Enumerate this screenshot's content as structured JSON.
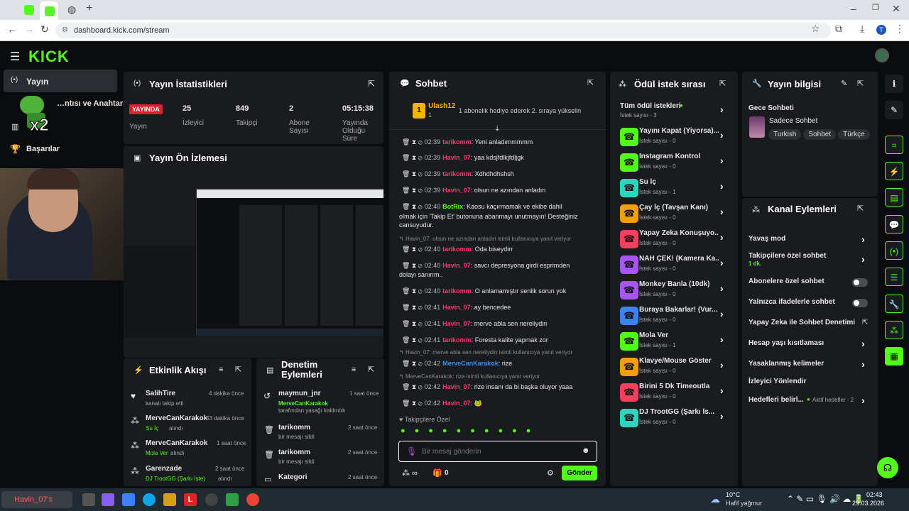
{
  "browser": {
    "url": "dashboard.kick.com/stream",
    "profile": "T"
  },
  "nav": {
    "items": [
      {
        "label": "Yayın"
      },
      {
        "label": "…ntısı ve Anahtarı"
      },
      {
        "label": "Başarılar"
      }
    ],
    "overlay_badge": "x2"
  },
  "stats": {
    "title": "Yayın İstatistikleri",
    "live_badge": "YAYINDA",
    "live_label": "Yayın",
    "viewers": "25",
    "viewers_label": "İzleyici",
    "followers": "849",
    "followers_label": "Takipçi",
    "subs": "2",
    "subs_label": "Abone Sayısı",
    "uptime": "05:15:38",
    "uptime_label": "Yayında Olduğu Süre"
  },
  "preview": {
    "title": "Yayın Ön İzlemesi"
  },
  "activity": {
    "title": "Etkinlik Akışı",
    "items": [
      {
        "user": "SalihTire",
        "time": "4 dakika önce",
        "desc": "kanalı takip etti"
      },
      {
        "user": "MerveCanKarakok",
        "time": "33 dakika önce",
        "reward": "Su İç",
        "desc": "alındı"
      },
      {
        "user": "MerveCanKarakok",
        "time": "1 saat önce",
        "reward": "Mola Ver",
        "desc": "alındı"
      },
      {
        "user": "Garenzade",
        "time": "2 saat önce",
        "reward": "DJ TrootGG (Şarkı İste)",
        "desc": "alındı"
      }
    ]
  },
  "moderation": {
    "title": "Denetim Eylemleri",
    "items": [
      {
        "user": "maymun_jnr",
        "time": "1 saat önce",
        "actor": "MerveCanKarakok",
        "desc": "tarafından yasağı kaldırıldı"
      },
      {
        "user": "tarikomm",
        "time": "2 saat önce",
        "desc": "bir mesajı sildi"
      },
      {
        "user": "tarikomm",
        "time": "2 saat önce",
        "desc": "bir mesajı sildi"
      },
      {
        "user": "Kategori",
        "time": "2 saat önce",
        "desc": ""
      }
    ]
  },
  "chat": {
    "title": "Sohbet",
    "pinned_user": "Ulash12",
    "pinned_count": "1",
    "pinned_text": "1 abonelik hediye ederek 2. sıraya yükselin",
    "messages": [
      {
        "time": "02:39",
        "user": "tarikomm",
        "color": "#ff3b6b",
        "text": "Yeni anladımmmmm"
      },
      {
        "time": "02:39",
        "user": "Havin_07",
        "color": "#ff3b6b",
        "text": "yaa kdsjfdlkjfdljgk"
      },
      {
        "time": "02:39",
        "user": "tarikomm",
        "color": "#ff3b6b",
        "text": "Xdhdhdhshsh"
      },
      {
        "time": "02:39",
        "user": "Havin_07",
        "color": "#ff3b6b",
        "text": "olsun ne azından anladın"
      },
      {
        "time": "02:40",
        "user": "BotRix",
        "color": "#53fc18",
        "text": "Kaosu kaçırmamak ve ekibe dahil"
      },
      {
        "time": "02:40",
        "user": "tarikomm",
        "color": "#ff3b6b",
        "text": "Oda biseydirr"
      },
      {
        "time": "02:40",
        "user": "Havin_07",
        "color": "#ff3b6b",
        "text": "savcı depresyona girdi esprimden"
      },
      {
        "time": "02:40",
        "user": "tarikomm",
        "color": "#ff3b6b",
        "text": "O anlamamıştır senlik sorun yok"
      },
      {
        "time": "02:41",
        "user": "Havin_07",
        "color": "#ff3b6b",
        "text": "ay bencedee"
      },
      {
        "time": "02:41",
        "user": "Havin_07",
        "color": "#ff3b6b",
        "text": "merve abla sen nereliydin"
      },
      {
        "time": "02:41",
        "user": "tarikomm",
        "color": "#ff3b6b",
        "text": "Foresta kalite yapmak zor"
      },
      {
        "time": "02:42",
        "user": "MerveCanKarakok",
        "color": "#3a8ef6",
        "text": "rize"
      },
      {
        "time": "02:42",
        "user": "Havin_07",
        "color": "#ff3b6b",
        "text": "rize insanı da bi başka oluyor yaaa"
      },
      {
        "time": "02:42",
        "user": "Havin_07",
        "color": "#ff3b6b",
        "text": ""
      }
    ],
    "botrix_cont": "olmak için 'Takip Et' butonuna abanmayı unutmayın! Desteğiniz cansuyudur.",
    "savci_cont": "dolayı sanırım..",
    "reply1": "Havin_07: olsun ne azından anladın isimli kullanıcıya yanıt veriyor",
    "reply2": "Havin_07: merve abla sen nereliydin isimli kullanıcıya yanıt veriyor",
    "reply3": "MerveCanKarakok: rize isimli kullanıcıya yanıt veriyor",
    "emote_label": "Takipçilere Özel",
    "placeholder": "Bir mesaj gönderin",
    "send": "Gönder",
    "points": "0"
  },
  "rewards": {
    "title": "Ödül istek sırası",
    "all": "Tüm ödül istekleri",
    "all_count": "İstek sayısı - 3",
    "items": [
      {
        "name": "Yayını Kapat (Yiyorsa)...",
        "count": "İstek sayısı - 0",
        "color": "#53fc18"
      },
      {
        "name": "Instagram Kontrol",
        "count": "İstek sayısı - 0",
        "color": "#53fc18"
      },
      {
        "name": "Su İç",
        "count": "İstek sayısı - 1",
        "color": "#2dd4bf"
      },
      {
        "name": "Çay İç (Tavşan Kanı)",
        "count": "İstek sayısı - 0",
        "color": "#f59e0b"
      },
      {
        "name": "Yapay Zeka Konuşuyo...",
        "count": "İstek sayısı - 0",
        "color": "#f43f5e"
      },
      {
        "name": "NAH ÇEK! (Kamera Ka...",
        "count": "İstek sayısı - 0",
        "color": "#a855f7"
      },
      {
        "name": "Monkey Banla (10dk)",
        "count": "İstek sayısı - 0",
        "color": "#a855f7"
      },
      {
        "name": "Buraya Bakarlar! (Vur...",
        "count": "İstek sayısı - 0",
        "color": "#3b82f6"
      },
      {
        "name": "Mola Ver",
        "count": "İstek sayısı - 1",
        "color": "#53fc18"
      },
      {
        "name": "Klavye/Mouse Göster",
        "count": "İstek sayısı - 0",
        "color": "#f59e0b"
      },
      {
        "name": "Birini 5 Dk Timeoutla",
        "count": "İstek sayısı - 0",
        "color": "#f43f5e"
      },
      {
        "name": "DJ TrootGG (Şarkı İs...",
        "count": "İstek sayısı - 0",
        "color": "#2dd4bf"
      }
    ]
  },
  "info": {
    "title": "Yayın bilgisi",
    "stream_title": "Gece Sohbeti",
    "category": "Sadece Sohbet",
    "tags": [
      "Turkish",
      "Sohbet",
      "Türkçe"
    ]
  },
  "actions": {
    "title": "Kanal Eylemleri",
    "items": [
      "Yavaş mod",
      "Takipçilere özel sohbet",
      "Abonelere özel sohbet",
      "Yalnızca ifadelerle sohbet",
      "Yapay Zeka ile Sohbet Denetimi",
      "Hesap yaşı kısıtlaması",
      "Yasaklanmış kelimeler",
      "İzleyici Yönlendir",
      "Hedefleri belirl..."
    ],
    "follower_sub": "1 dk.",
    "goals_sub": "Aktif hedefler - 2"
  },
  "taskbar": {
    "weather_temp": "10°C",
    "weather_desc": "Hafif yağmur",
    "time": "02:43",
    "date": "29.03.2026",
    "overlay_text": "Havin_07's"
  }
}
